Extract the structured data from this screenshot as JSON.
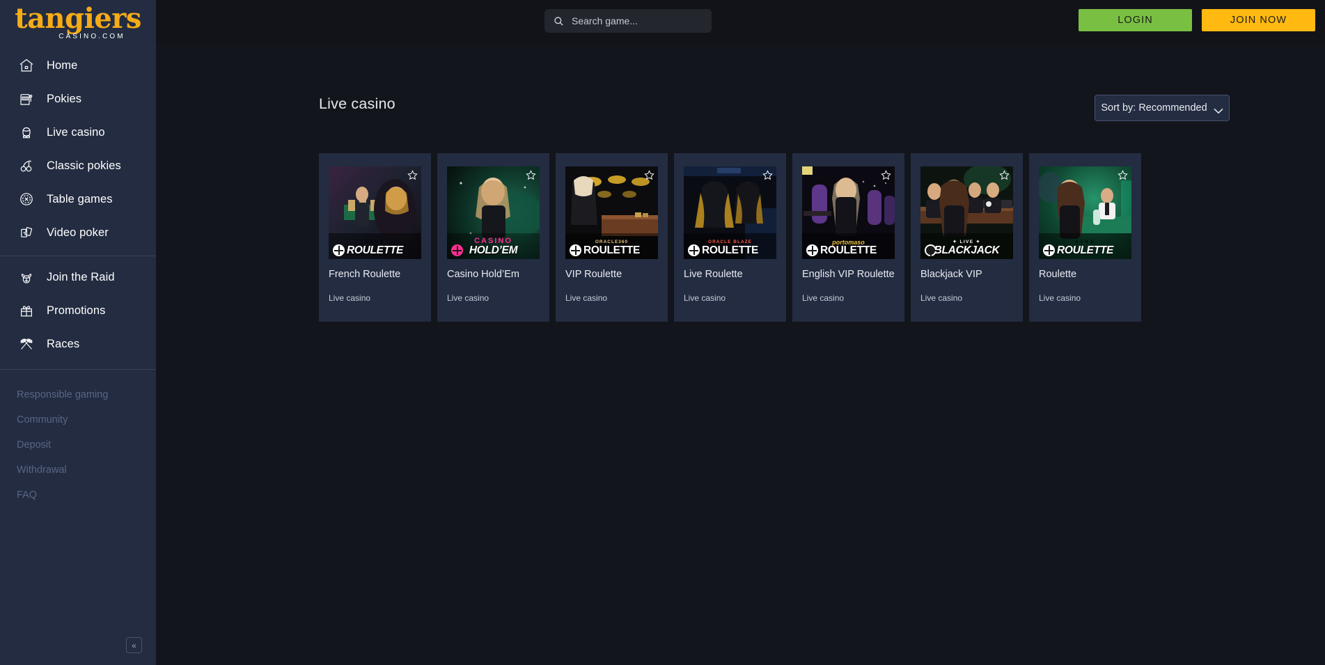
{
  "brand": {
    "name": "tangiers",
    "sub": "CASINO.COM",
    "color": "#f5ac18"
  },
  "sidebar": {
    "primary_items": [
      {
        "label": "Home",
        "icon": "home-icon"
      },
      {
        "label": "Pokies",
        "icon": "slot-machine-icon"
      },
      {
        "label": "Live casino",
        "icon": "live-dealer-icon"
      },
      {
        "label": "Classic pokies",
        "icon": "cherries-icon"
      },
      {
        "label": "Table games",
        "icon": "casino-chip-icon"
      },
      {
        "label": "Video poker",
        "icon": "playing-cards-icon"
      }
    ],
    "secondary_items": [
      {
        "label": "Join the Raid",
        "icon": "viking-helmet-icon"
      },
      {
        "label": "Promotions",
        "icon": "gift-icon"
      },
      {
        "label": "Races",
        "icon": "checkered-flags-icon"
      }
    ],
    "footer_links": [
      "Responsible gaming",
      "Community",
      "Deposit",
      "Withdrawal",
      "FAQ"
    ],
    "collapse_glyph": "«"
  },
  "header": {
    "search": {
      "placeholder": "Search game...",
      "value": "",
      "icon": "search-icon"
    },
    "login_label": "LOGIN",
    "join_label": "JOIN NOW",
    "login_color": "#79bf42",
    "join_color": "#ffb911"
  },
  "main": {
    "page_title": "Live casino",
    "sort": {
      "label": "Sort by: Recommended",
      "icon": "chevron-down-icon"
    }
  },
  "games": [
    {
      "title": "French Roulette",
      "category": "Live casino",
      "banner_top": "L I V E",
      "banner_main": "ROULETTE",
      "banner_top_color": "#ffffff",
      "favorited": false
    },
    {
      "title": "Casino Hold’Em",
      "category": "Live casino",
      "banner_top": "CASINO",
      "banner_main": "HOLD’EM",
      "banner_top_color": "#ff2f92",
      "favorited": false
    },
    {
      "title": "VIP Roulette",
      "category": "Live casino",
      "banner_top": "ORACLE360",
      "banner_main": "ROULETTE",
      "banner_top_color": "#e8c87a",
      "favorited": false
    },
    {
      "title": "Live Roulette",
      "category": "Live casino",
      "banner_top": "ORACLE BLAZE",
      "banner_main": "ROULETTE",
      "banner_top_color": "#ff5a3c",
      "favorited": false
    },
    {
      "title": "English VIP Roulette",
      "category": "Live casino",
      "banner_top": "portomaso",
      "banner_main": "ROULETTE",
      "banner_top_color": "#e8c040",
      "favorited": false
    },
    {
      "title": "Blackjack VIP",
      "category": "Live casino",
      "banner_top": "✦ LIVE ✦",
      "banner_main": "BLACKJACK",
      "banner_top_color": "#ffffff",
      "favorited": false
    },
    {
      "title": "Roulette",
      "category": "Live casino",
      "banner_top": "L I V E",
      "banner_main": "ROULETTE",
      "banner_top_color": "#ffffff",
      "favorited": false
    }
  ]
}
